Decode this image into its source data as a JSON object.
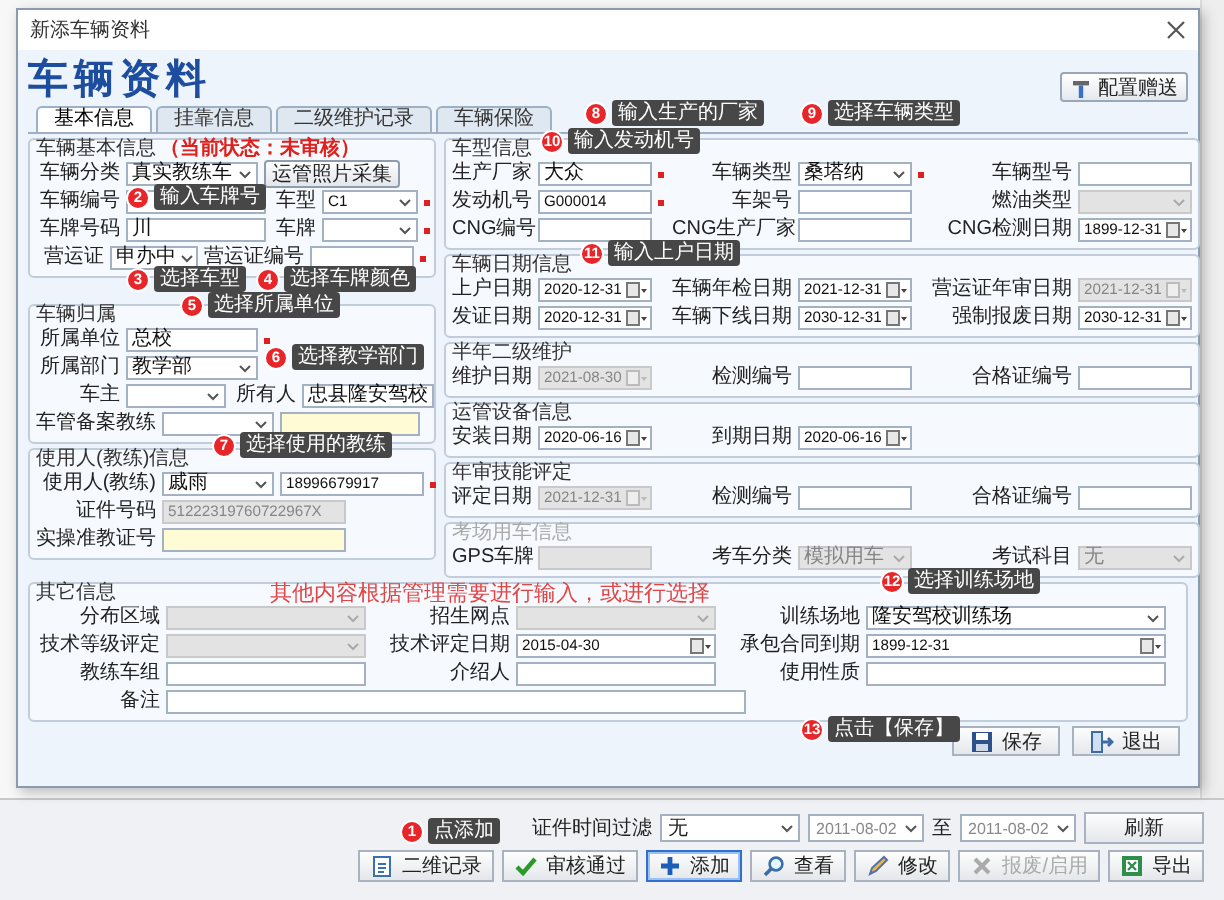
{
  "window": {
    "title": "新添车辆资料"
  },
  "heading": "车辆资料",
  "tabs": [
    {
      "label": "基本信息",
      "selected": true
    },
    {
      "label": "挂靠信息",
      "selected": false
    },
    {
      "label": "二级维护记录",
      "selected": false
    },
    {
      "label": "车辆保险",
      "selected": false
    }
  ],
  "config_button": "配置赠送",
  "left_groups": [
    {
      "title": "车辆基本信息",
      "status": "（当前状态：未审核）",
      "disabled": false,
      "rows": [
        [
          {
            "label": "车辆分类",
            "kind": "select",
            "value": "真实教练车",
            "disabled": false,
            "required": false
          },
          {
            "kind": "button",
            "value": "运管照片采集",
            "disabled": false,
            "required": false
          }
        ],
        [
          {
            "label": "车辆编号",
            "kind": "text",
            "disabled": false,
            "required": false
          },
          {
            "label": "车型",
            "kind": "select",
            "value": "C1",
            "disabled": false,
            "required": true
          }
        ],
        [
          {
            "label": "车牌号码",
            "kind": "text",
            "value": "川",
            "disabled": false,
            "required": false
          },
          {
            "label": "车牌",
            "kind": "select",
            "disabled": false,
            "required": true
          }
        ],
        [
          {
            "label": "营运证",
            "kind": "select",
            "value": "申办中",
            "disabled": false,
            "required": false
          },
          {
            "label": "营运证编号",
            "kind": "text",
            "disabled": false,
            "required": true
          }
        ]
      ]
    },
    {
      "title": "车辆归属",
      "disabled": false,
      "rows": [
        [
          {
            "label": "所属单位",
            "kind": "text",
            "value": "总校",
            "disabled": false,
            "required": true
          }
        ],
        [
          {
            "label": "所属部门",
            "kind": "select",
            "value": "教学部",
            "disabled": false,
            "required": false
          }
        ],
        [
          {
            "label": "车主",
            "kind": "select",
            "disabled": false,
            "required": false
          },
          {
            "label": "所有人",
            "kind": "text",
            "value": "忠县隆安驾校",
            "disabled": false,
            "required": false
          }
        ],
        [
          {
            "label": "车管备案教练",
            "kind": "select",
            "disabled": false,
            "required": false
          },
          {
            "kind": "note",
            "disabled": false,
            "required": false
          }
        ]
      ]
    },
    {
      "title": "使用人(教练)信息",
      "disabled": false,
      "rows": [
        [
          {
            "label": "使用人(教练)",
            "kind": "select",
            "value": "戚雨",
            "disabled": false,
            "required": false
          },
          {
            "kind": "text",
            "value": "18996679917",
            "disabled": false,
            "required": true
          }
        ],
        [
          {
            "label": "证件号码",
            "kind": "text",
            "value": "51222319760722967X",
            "disabled": true,
            "required": false
          }
        ],
        [
          {
            "label": "实操准教证号",
            "kind": "note",
            "disabled": false,
            "required": false
          }
        ]
      ]
    }
  ],
  "right_groups": [
    {
      "title": "车型信息",
      "disabled": false,
      "rows": [
        [
          {
            "label": "生产厂家",
            "kind": "text",
            "value": "大众",
            "disabled": false,
            "required": true
          },
          {
            "label": "车辆类型",
            "kind": "select",
            "value": "桑塔纳",
            "disabled": false,
            "required": true
          },
          {
            "label": "车辆型号",
            "kind": "text",
            "disabled": false,
            "required": false
          }
        ],
        [
          {
            "label": "发动机号",
            "kind": "text",
            "value": "G000014",
            "disabled": false,
            "required": true
          },
          {
            "label": "车架号",
            "kind": "text",
            "disabled": false,
            "required": false
          },
          {
            "label": "燃油类型",
            "kind": "select",
            "disabled": true,
            "required": false
          }
        ],
        [
          {
            "label": "CNG编号",
            "kind": "text",
            "disabled": false,
            "required": false
          },
          {
            "label": "CNG生产厂家",
            "kind": "text",
            "disabled": false,
            "required": false
          },
          {
            "label": "CNG检测日期",
            "kind": "date",
            "value": "1899-12-31",
            "disabled": false,
            "required": false
          }
        ]
      ]
    },
    {
      "title": "车辆日期信息",
      "disabled": false,
      "rows": [
        [
          {
            "label": "上户日期",
            "kind": "date",
            "value": "2020-12-31",
            "disabled": false,
            "required": false
          },
          {
            "label": "车辆年检日期",
            "kind": "date",
            "value": "2021-12-31",
            "disabled": false,
            "required": false
          },
          {
            "label": "营运证年审日期",
            "kind": "date",
            "value": "2021-12-31",
            "disabled": true,
            "required": false
          }
        ],
        [
          {
            "label": "发证日期",
            "kind": "date",
            "value": "2020-12-31",
            "disabled": false,
            "required": false
          },
          {
            "label": "车辆下线日期",
            "kind": "date",
            "value": "2030-12-31",
            "disabled": false,
            "required": false
          },
          {
            "label": "强制报废日期",
            "kind": "date",
            "value": "2030-12-31",
            "disabled": false,
            "required": false
          }
        ]
      ]
    },
    {
      "title": "半年二级维护",
      "disabled": false,
      "rows": [
        [
          {
            "label": "维护日期",
            "kind": "date",
            "value": "2021-08-30",
            "disabled": true,
            "required": false
          },
          {
            "label": "检测编号",
            "kind": "text",
            "disabled": false,
            "required": false
          },
          {
            "label": "合格证编号",
            "kind": "text",
            "disabled": false,
            "required": false
          }
        ]
      ]
    },
    {
      "title": "运管设备信息",
      "disabled": false,
      "rows": [
        [
          {
            "label": "安装日期",
            "kind": "date",
            "value": "2020-06-16",
            "disabled": false,
            "required": false
          },
          {
            "label": "到期日期",
            "kind": "date",
            "value": "2020-06-16",
            "disabled": false,
            "required": false
          }
        ]
      ]
    },
    {
      "title": "年审技能评定",
      "disabled": false,
      "rows": [
        [
          {
            "label": "评定日期",
            "kind": "date",
            "value": "2021-12-31",
            "disabled": true,
            "required": false
          },
          {
            "label": "检测编号",
            "kind": "text",
            "disabled": false,
            "required": false
          },
          {
            "label": "合格证编号",
            "kind": "text",
            "disabled": false,
            "required": false
          }
        ]
      ]
    },
    {
      "title": "考场用车信息",
      "disabled": true,
      "rows": [
        [
          {
            "label": "GPS车牌",
            "kind": "text",
            "disabled": true,
            "required": false
          },
          {
            "label": "考车分类",
            "kind": "select",
            "value": "模拟用车",
            "disabled": true,
            "required": false
          },
          {
            "label": "考试科目",
            "kind": "select",
            "value": "无",
            "disabled": true,
            "required": false
          }
        ]
      ]
    }
  ],
  "other_group": {
    "title": "其它信息",
    "disabled": false,
    "note": "其他内容根据管理需要进行输入，或进行选择",
    "rows": [
      [
        {
          "label": "分布区域",
          "kind": "select",
          "disabled": true,
          "required": false
        },
        {
          "label": "招生网点",
          "kind": "select",
          "disabled": true,
          "required": false
        },
        {
          "label": "训练场地",
          "kind": "select",
          "value": "隆安驾校训练场",
          "disabled": false,
          "required": false
        }
      ],
      [
        {
          "label": "技术等级评定",
          "kind": "select",
          "disabled": true,
          "required": false
        },
        {
          "label": "技术评定日期",
          "kind": "date",
          "value": "2015-04-30",
          "disabled": false,
          "required": false
        },
        {
          "label": "承包合同到期",
          "kind": "date",
          "value": "1899-12-31",
          "disabled": false,
          "required": false
        }
      ],
      [
        {
          "label": "教练车组",
          "kind": "text",
          "disabled": false,
          "required": false
        },
        {
          "label": "介绍人",
          "kind": "text",
          "disabled": false,
          "required": false
        },
        {
          "label": "使用性质",
          "kind": "text",
          "disabled": false,
          "required": false
        }
      ],
      [
        {
          "label": "备注",
          "kind": "text",
          "disabled": false,
          "required": false
        }
      ]
    ]
  },
  "dialog_buttons": [
    {
      "kind": "save",
      "label": "保存"
    },
    {
      "kind": "exit",
      "label": "退出"
    }
  ],
  "filter": {
    "label": "证件时间过滤",
    "value": "无",
    "from": "2011-08-02",
    "separator": "至",
    "to": "2011-08-02",
    "refresh": "刷新"
  },
  "toolbar": [
    {
      "kind": "record",
      "label": "二维记录",
      "disabled": false,
      "focused": false
    },
    {
      "kind": "approve",
      "label": "审核通过",
      "disabled": false,
      "focused": false
    },
    {
      "kind": "add",
      "label": "添加",
      "disabled": false,
      "focused": true
    },
    {
      "kind": "view",
      "label": "查看",
      "disabled": false,
      "focused": false
    },
    {
      "kind": "edit",
      "label": "修改",
      "disabled": false,
      "focused": false
    },
    {
      "kind": "scrap",
      "label": "报废/启用",
      "disabled": true,
      "focused": false
    },
    {
      "kind": "export",
      "label": "导出",
      "disabled": false,
      "focused": false
    }
  ],
  "callouts": [
    {
      "number": "1",
      "text": "点添加"
    },
    {
      "number": "2",
      "text": "输入车牌号"
    },
    {
      "number": "3",
      "text": "选择车型"
    },
    {
      "number": "4",
      "text": "选择车牌颜色"
    },
    {
      "number": "5",
      "text": "选择所属单位"
    },
    {
      "number": "6",
      "text": "选择教学部门"
    },
    {
      "number": "7",
      "text": "选择使用的教练"
    },
    {
      "number": "8",
      "text": "输入生产的厂家"
    },
    {
      "number": "9",
      "text": "选择车辆类型"
    },
    {
      "number": "10",
      "text": "输入发动机号"
    },
    {
      "number": "11",
      "text": "输入上户日期"
    },
    {
      "number": "12",
      "text": "选择训练场地"
    },
    {
      "number": "13",
      "text": "点击【保存】"
    }
  ]
}
